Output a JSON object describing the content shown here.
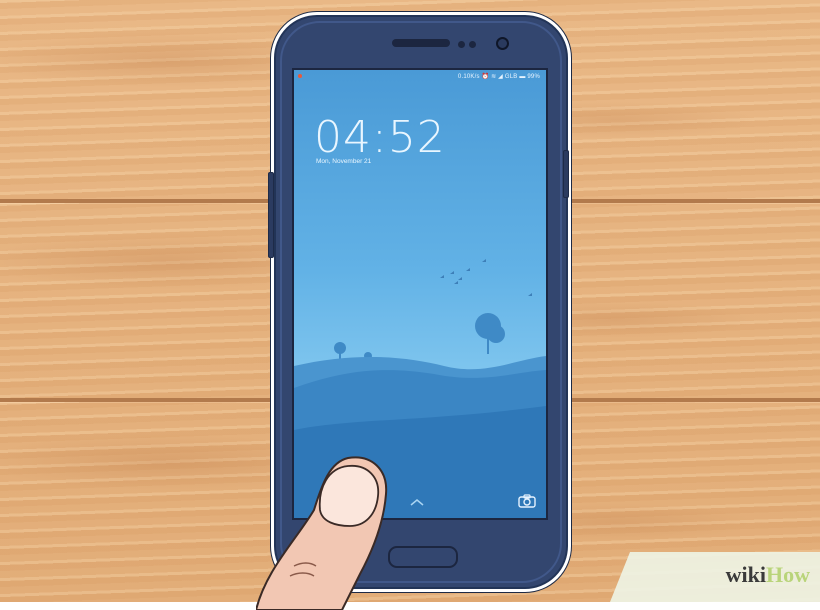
{
  "lockscreen": {
    "status": "0.10K/s ⏰ ≋ ◢ GLB ▬ 99%",
    "time": "04:52",
    "date": "Mon, November 21"
  },
  "watermark": {
    "wiki": "wiki",
    "how": "How"
  },
  "colors": {
    "phone_body": "#33466f",
    "screen_sky": "#62b2e6",
    "hills": "#3b86c4",
    "wood": "#e6b37f"
  },
  "icons": [
    "camera-icon",
    "chevron-up-icon",
    "status-dot-icon"
  ]
}
